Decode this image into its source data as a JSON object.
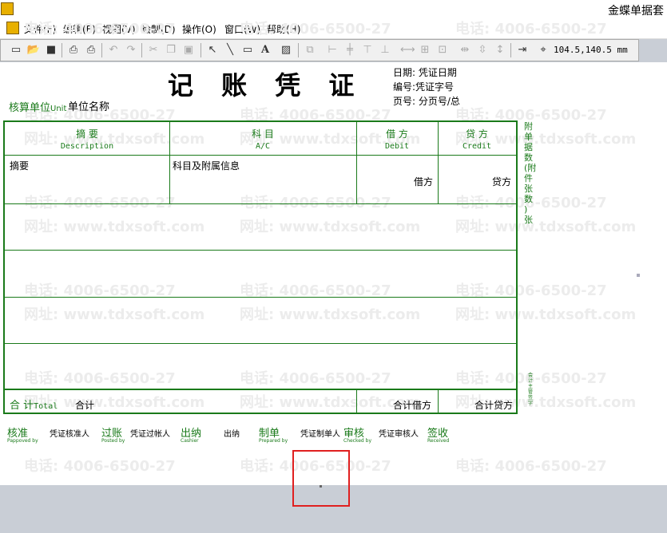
{
  "window": {
    "title": "金蝶单据套"
  },
  "menu": [
    "文件(F)",
    "编辑(E)",
    "视图(V)",
    "绘制(D)",
    "操作(O)",
    "窗口(W)",
    "帮助(H)"
  ],
  "toolbar": {
    "size_readout": "104.5,140.5 mm"
  },
  "watermark": {
    "phone": "电话: 4006-6500-27",
    "site": "网址: www.tdxsoft.com"
  },
  "voucher": {
    "title": "记 账 凭 证",
    "date_label": "日期:",
    "date_value": "凭证日期",
    "no_label": "编号:",
    "no_value": "凭证字号",
    "page_label": "页号:",
    "page_value": "分页号/总",
    "unit_label_cn": "核算单位",
    "unit_label_en": "Unit",
    "unit_value": "单位名称",
    "headers": [
      {
        "cn": "摘  要",
        "en": "Description"
      },
      {
        "cn": "科  目",
        "en": "A/C"
      },
      {
        "cn": "借  方",
        "en": "Debit"
      },
      {
        "cn": "贷  方",
        "en": "Credit"
      }
    ],
    "row1": {
      "desc": "摘要",
      "account": "科目及附属信息",
      "debit": "借方",
      "credit": "贷方"
    },
    "total_label_cn": "合 计",
    "total_label_en": "Total",
    "total_value": "合计",
    "total_debit": "合计借方",
    "total_credit": "合计贷方",
    "attach_text": "附单据数(附件张数 )张",
    "side_note": "会计主管签字"
  },
  "signatures": [
    {
      "cn": "核准",
      "en": "Pappoved by",
      "value": "凭证核准人"
    },
    {
      "cn": "过账",
      "en": "Posted by",
      "value": "凭证过帐人"
    },
    {
      "cn": "出纳",
      "en": "Cashier",
      "value": "出纳"
    },
    {
      "cn": "制单",
      "en": "Prepared by",
      "value": "凭证制单人"
    },
    {
      "cn": "审核",
      "en": "Checked by",
      "value": "凭证审核人"
    },
    {
      "cn": "签收",
      "en": "Received",
      "value": ""
    }
  ]
}
